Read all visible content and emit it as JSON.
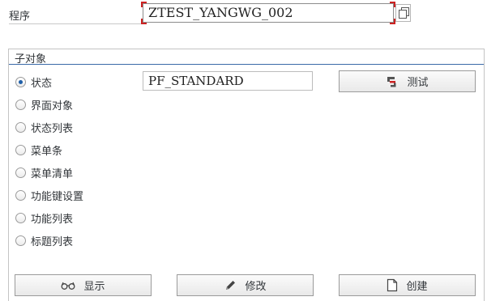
{
  "program": {
    "label": "程序",
    "value": "ZTEST_YANGWG_002"
  },
  "group": {
    "title": "子对象"
  },
  "subobjects": [
    {
      "label": "状态",
      "checked": true
    },
    {
      "label": "界面对象",
      "checked": false
    },
    {
      "label": "状态列表",
      "checked": false
    },
    {
      "label": "菜单条",
      "checked": false
    },
    {
      "label": "菜单清单",
      "checked": false
    },
    {
      "label": "功能键设置",
      "checked": false
    },
    {
      "label": "功能列表",
      "checked": false
    },
    {
      "label": "标题列表",
      "checked": false
    }
  ],
  "status_value": "PF_STANDARD",
  "buttons": {
    "test": "测试",
    "display": "显示",
    "change": "修改",
    "create": "创建"
  },
  "icons": {
    "test": "test-icon",
    "display": "glasses-icon",
    "change": "pencil-icon",
    "create": "document-icon",
    "f4": "copy-icon"
  },
  "colors": {
    "focus_corner": "#cc2222",
    "group_line": "#3a6aa8",
    "radio_selected": "#1f5fa8"
  }
}
